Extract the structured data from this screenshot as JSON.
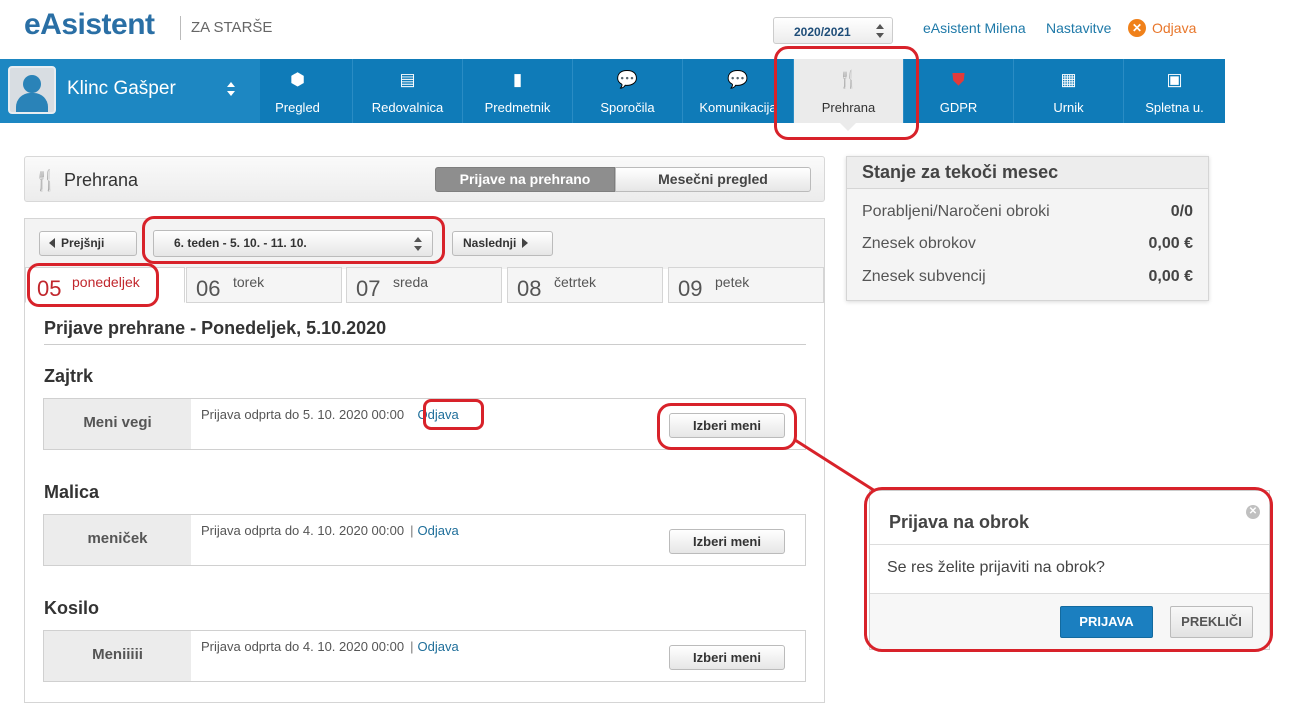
{
  "header": {
    "logo": "eAsistent",
    "logo_sub": "ZA STARŠE",
    "school_year": "2020/2021",
    "user_link": "eAsistent Milena",
    "settings_link": "Nastavitve",
    "logout_link": "Odjava"
  },
  "nav": {
    "student_name": "Klinc Gašper",
    "items": [
      {
        "label": "Pregled",
        "icon": "cube-icon"
      },
      {
        "label": "Redovalnica",
        "icon": "id-card-icon"
      },
      {
        "label": "Predmetnik",
        "icon": "book-icon"
      },
      {
        "label": "Sporočila",
        "icon": "chat-icon"
      },
      {
        "label": "Komunikacija",
        "icon": "chat-icon"
      },
      {
        "label": "Prehrana",
        "icon": "food-icon"
      },
      {
        "label": "GDPR",
        "icon": "shield-icon"
      },
      {
        "label": "Urnik",
        "icon": "calendar-icon"
      },
      {
        "label": "Spletna u.",
        "icon": "web-icon"
      }
    ],
    "active": "Prehrana"
  },
  "prehrana": {
    "title": "Prehrana",
    "tab_active": "Prijave na prehrano",
    "tab_other": "Mesečni pregled"
  },
  "week": {
    "prev": "Prejšnji",
    "next": "Naslednji",
    "selected": "6. teden - 5. 10. - 11. 10.",
    "days": [
      {
        "num": "05",
        "name": "ponedeljek",
        "active": true
      },
      {
        "num": "06",
        "name": "torek",
        "active": false
      },
      {
        "num": "07",
        "name": "sreda",
        "active": false
      },
      {
        "num": "08",
        "name": "četrtek",
        "active": false
      },
      {
        "num": "09",
        "name": "petek",
        "active": false
      }
    ]
  },
  "day": {
    "title": "Prijave prehrane - Ponedeljek, 5.10.2020",
    "meals": [
      {
        "title": "Zajtrk",
        "menu": "Meni vegi",
        "info": "Prijava odprta do 5. 10. 2020 00:00",
        "action": "Odjava",
        "button": "Izberi meni"
      },
      {
        "title": "Malica",
        "menu": "meniček",
        "info": "Prijava odprta do 4. 10. 2020 00:00",
        "action": "Odjava",
        "button": "Izberi meni"
      },
      {
        "title": "Kosilo",
        "menu": "Meniiiii",
        "info": "Prijava odprta do 4. 10. 2020 00:00",
        "action": "Odjava",
        "button": "Izberi meni"
      }
    ]
  },
  "summary": {
    "title": "Stanje za tekoči mesec",
    "rows": [
      {
        "label": "Porabljeni/Naročeni obroki",
        "value": "0/0"
      },
      {
        "label": "Znesek obrokov",
        "value": "0,00 €"
      },
      {
        "label": "Znesek subvencij",
        "value": "0,00 €"
      }
    ]
  },
  "modal": {
    "title": "Prijava na obrok",
    "body": "Se res želite prijaviti na obrok?",
    "confirm": "PRIJAVA",
    "cancel": "PREKLIČI"
  },
  "colors": {
    "nav_blue": "#0f7bb8",
    "accent_red": "#c1272d",
    "annotation_red": "#d8222a",
    "link_blue": "#1e79a8",
    "primary_button": "#1b7fc0",
    "logout_orange": "#f0811a"
  }
}
